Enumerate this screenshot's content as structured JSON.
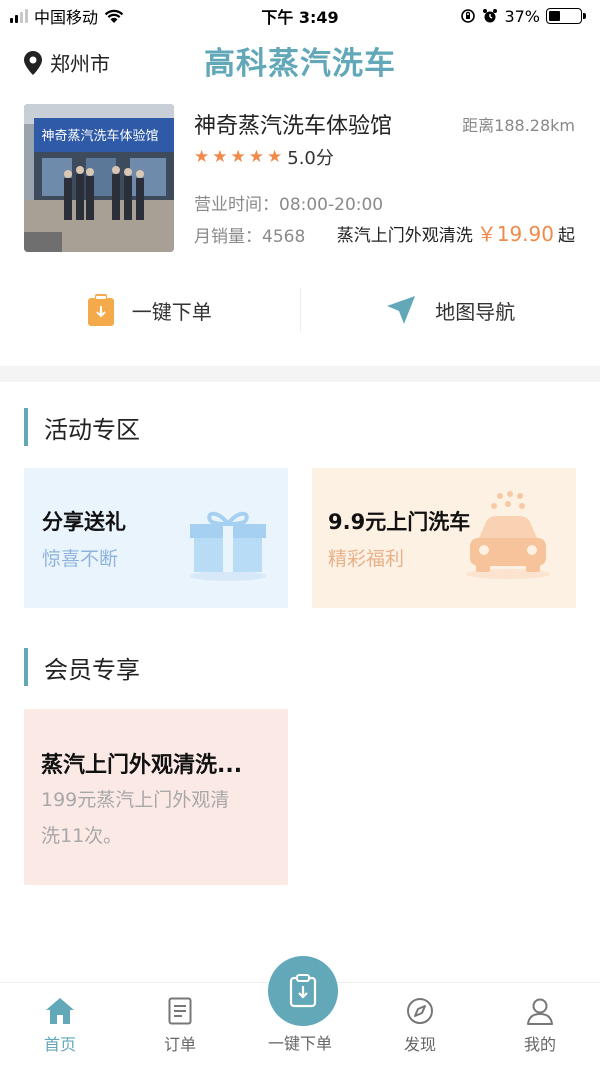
{
  "status_bar": {
    "carrier": "中国移动",
    "time": "下午 3:49",
    "battery_percent": "37%",
    "battery_level": 0.37
  },
  "header": {
    "city": "郑州市",
    "app_title": "高科蒸汽洗车"
  },
  "shop": {
    "name": "神奇蒸汽洗车体验馆",
    "distance": "距离188.28km",
    "photo_sign": "神奇蒸汽洗车体验馆",
    "rating_stars": 5,
    "rating_value": "5.0分",
    "hours": "营业时间：08:00-20:00",
    "monthly_sales": "月销量：4568",
    "service_name": "蒸汽上门外观清洗",
    "price": "￥19.90",
    "price_suffix": "起"
  },
  "actions": {
    "order_label": "一键下单",
    "navigate_label": "地图导航"
  },
  "activities": {
    "title": "活动专区",
    "share": {
      "title": "分享送礼",
      "subtitle": "惊喜不断"
    },
    "wash": {
      "title": "9.9元上门洗车",
      "subtitle": "精彩福利"
    }
  },
  "members": {
    "title": "会员专享",
    "card": {
      "title": "蒸汽上门外观清洗...",
      "desc_line1": "199元蒸汽上门外观清",
      "desc_line2": "洗11次。"
    }
  },
  "tab_bar": {
    "home": "首页",
    "orders": "订单",
    "quick_order": "一键下单",
    "discover": "发现",
    "mine": "我的"
  },
  "colors": {
    "accent": "#62a8b8",
    "price": "#f08a4b",
    "share_tile_bg": "#eaf4fd",
    "wash_tile_bg": "#fdf1e4",
    "member_tile_bg": "#fbe9e6"
  }
}
